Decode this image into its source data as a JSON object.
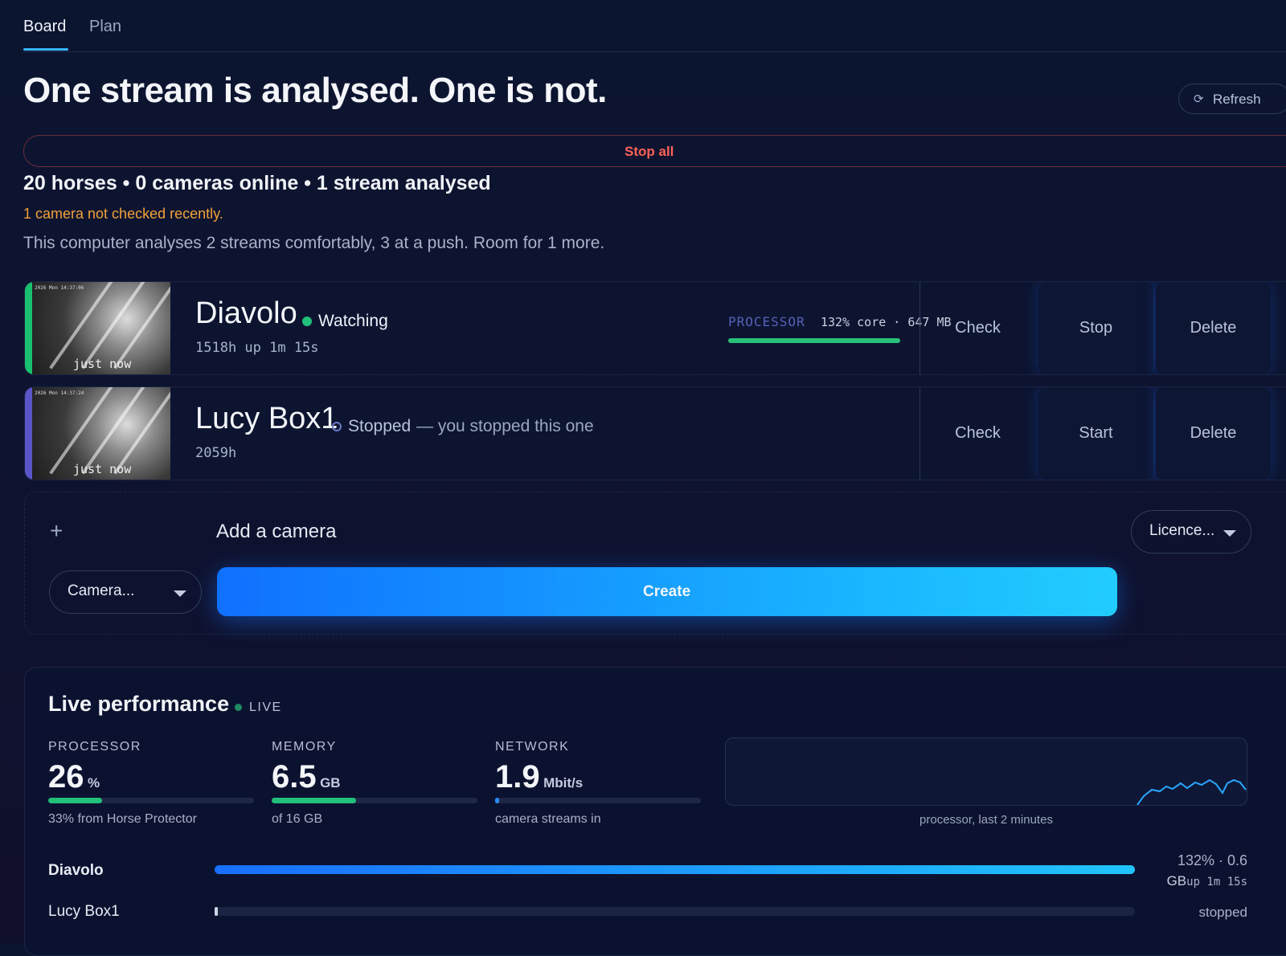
{
  "tabs": [
    {
      "label": "Board"
    },
    {
      "label": "Plan"
    }
  ],
  "headline": "One stream is analysed. One is not.",
  "refresh_label": "Refresh",
  "stop_all_label": "Stop all",
  "summary": "20 horses • 0 cameras online • 1 stream analysed",
  "warning": "1 camera not checked recently.",
  "capacity": "This computer analyses 2 streams comfortably, 3 at a push. Room for 1 more.",
  "cameras": [
    {
      "name": "Diavolo",
      "status": "Watching",
      "status_color": "#22c07a",
      "meta": "1518h   up 1m 15s",
      "last_seen": "just now",
      "processor_label": "PROCESSOR",
      "processor_value": "132% core · 647 MB",
      "processor_fill": 1.0,
      "accent": "#18c070",
      "actions": [
        "Check",
        "Stop",
        "Delete"
      ]
    },
    {
      "name": "Lucy Box1",
      "status": "Stopped",
      "status_note": "— you stopped this one",
      "status_color": "#6b7bc8",
      "meta": "2059h",
      "last_seen": "just now",
      "accent": "#5a55c8",
      "actions": [
        "Check",
        "Start",
        "Delete"
      ]
    }
  ],
  "add_camera": {
    "title": "Add a camera",
    "licence_placeholder": "Licence...",
    "camera_placeholder": "Camera...",
    "create_label": "Create"
  },
  "performance": {
    "title": "Live performance",
    "live_label": "LIVE",
    "metrics": [
      {
        "label": "PROCESSOR",
        "value": "26",
        "unit": "%",
        "sub": "33% from Horse Protector",
        "fill": 0.26,
        "color": "#22c07a"
      },
      {
        "label": "MEMORY",
        "value": "6.5",
        "unit": "GB",
        "sub": "of 16 GB",
        "fill": 0.41,
        "color": "#22c07a"
      },
      {
        "label": "NETWORK",
        "value": "1.9",
        "unit": "Mbit/s",
        "sub": "camera streams in",
        "fill": 0.02,
        "color": "#2a8cff"
      }
    ],
    "spark_caption": "processor, last 2 minutes",
    "streams": [
      {
        "name": "Diavolo",
        "right_top": "132% · 0.6",
        "right_bottom_a": "GB",
        "right_bottom_b": "up 1m 15s",
        "fill": 1.0
      },
      {
        "name": "Lucy Box1",
        "right": "stopped",
        "fill": 0.003
      }
    ]
  }
}
